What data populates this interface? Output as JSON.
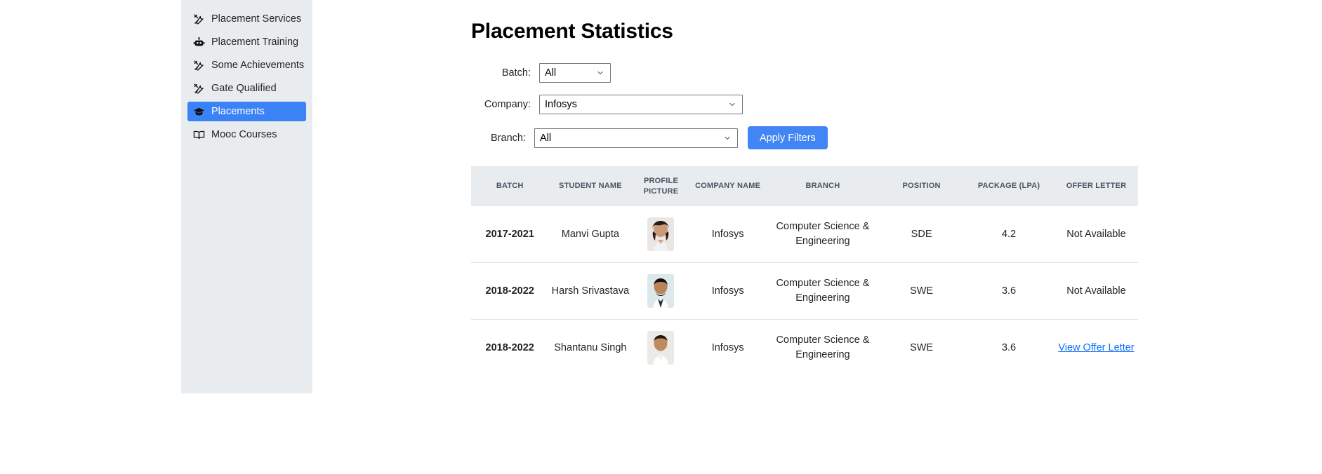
{
  "sidebar": {
    "items": [
      {
        "label": "Placement Services",
        "icon": "tools-icon",
        "active": false
      },
      {
        "label": "Placement Training",
        "icon": "robot-icon",
        "active": false
      },
      {
        "label": "Some Achievements",
        "icon": "tools-icon",
        "active": false
      },
      {
        "label": "Gate Qualified",
        "icon": "tools-icon",
        "active": false
      },
      {
        "label": "Placements",
        "icon": "graduation-cap-icon",
        "active": true
      },
      {
        "label": "Mooc Courses",
        "icon": "book-icon",
        "active": false
      }
    ],
    "active_color": "#3b82f6",
    "background_color": "#e9ecef"
  },
  "main": {
    "title": "Placement Statistics"
  },
  "filters": {
    "batch": {
      "label": "Batch:",
      "value": "All"
    },
    "company": {
      "label": "Company:",
      "value": "Infosys"
    },
    "branch": {
      "label": "Branch:",
      "value": "All"
    },
    "apply_button": "Apply Filters",
    "button_color": "#4285f4"
  },
  "table": {
    "headers": {
      "batch": "BATCH",
      "student_name": "STUDENT NAME",
      "profile_picture": "PROFILE PICTURE",
      "company_name": "COMPANY NAME",
      "branch": "BRANCH",
      "position": "POSITION",
      "package": "PACKAGE (LPA)",
      "offer_letter": "OFFER LETTER"
    },
    "rows": [
      {
        "batch": "2017-2021",
        "student_name": "Manvi Gupta",
        "company_name": "Infosys",
        "branch": "Computer Science & Engineering",
        "position": "SDE",
        "package": "4.2",
        "offer_letter": "Not Available",
        "offer_is_link": false
      },
      {
        "batch": "2018-2022",
        "student_name": "Harsh Srivastava",
        "company_name": "Infosys",
        "branch": "Computer Science & Engineering",
        "position": "SWE",
        "package": "3.6",
        "offer_letter": "Not Available",
        "offer_is_link": false
      },
      {
        "batch": "2018-2022",
        "student_name": "Shantanu Singh",
        "company_name": "Infosys",
        "branch": "Computer Science & Engineering",
        "position": "SWE",
        "package": "3.6",
        "offer_letter": "View Offer Letter",
        "offer_is_link": true
      }
    ],
    "header_bg": "#e9ecef",
    "link_color": "#0d6efd"
  }
}
